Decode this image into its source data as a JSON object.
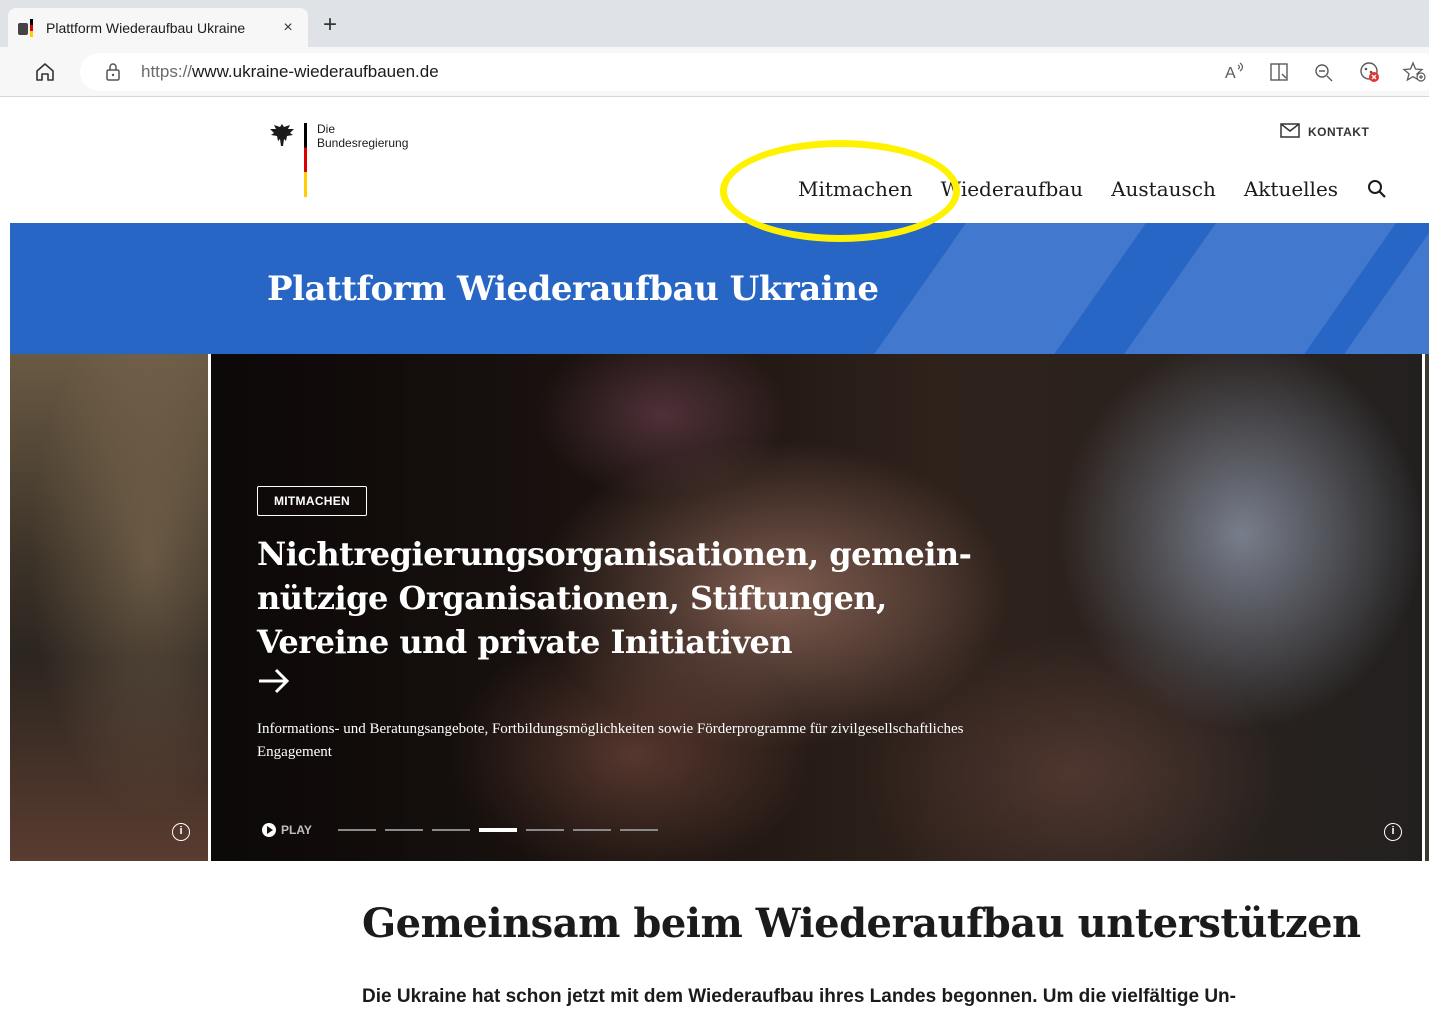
{
  "browser": {
    "tab_title": "Plattform Wiederaufbau Ukraine",
    "tab_close": "×",
    "new_tab": "+",
    "url_protocol": "https://",
    "url_host": "www.ukraine-wiederaufbauen.de",
    "icons": [
      "home-icon",
      "lock-icon",
      "read-aloud-icon",
      "immersive-reader-icon",
      "zoom-out-icon",
      "tracking-prevention-icon",
      "add-favorite-icon"
    ]
  },
  "header": {
    "logo_line1": "Die",
    "logo_line2": "Bundesregierung",
    "kontakt": "KONTAKT",
    "nav": {
      "mitmachen": "Mitmachen",
      "wiederaufbau": "Wiederaufbau",
      "austausch": "Austausch",
      "aktuelles": "Aktuelles"
    },
    "highlight_color": "#fff200"
  },
  "banner": {
    "title": "Plattform Wiederaufbau Ukraine",
    "color": "#2866c6"
  },
  "hero": {
    "badge": "MITMACHEN",
    "heading": "Nichtregierungsorganisationen, gemein­nützige Organisationen, Stiftungen, Vereine und private Initiativen",
    "description": "Informations- und Beratungsangebote, Fortbildungsmöglichkeiten sowie Förderprogramme für zivilge­sellschaftliches Engagement",
    "play_label": "PLAY",
    "slide_count": 7,
    "active_slide": 4,
    "info_glyph": "i"
  },
  "intro": {
    "title": "Gemeinsam beim Wiederaufbau unterstützen",
    "text": "Die Ukraine hat schon jetzt mit dem Wiederaufbau ihres Landes begonnen. Um die vielfältige Un-"
  }
}
